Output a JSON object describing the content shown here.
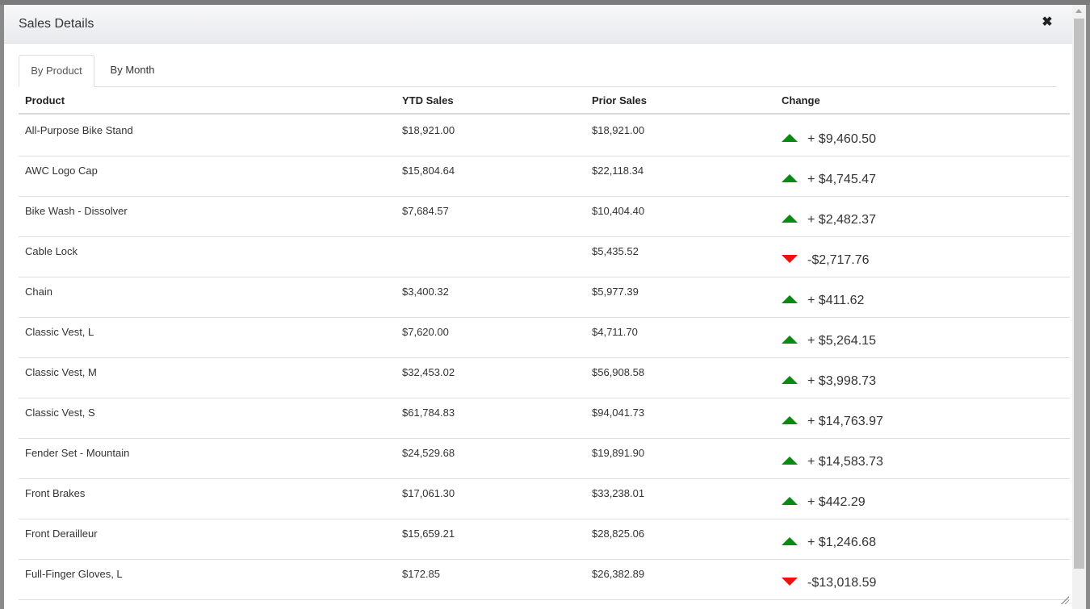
{
  "dialog": {
    "title": "Sales Details",
    "close_icon": "✖"
  },
  "tabs": [
    {
      "label": "By Product",
      "active": true
    },
    {
      "label": "By Month",
      "active": false
    }
  ],
  "table": {
    "columns": [
      "Product",
      "YTD Sales",
      "Prior Sales",
      "Change"
    ],
    "rows": [
      {
        "product": "All-Purpose Bike Stand",
        "ytd": "$18,921.00",
        "prior": "$18,921.00",
        "change": "+ $9,460.50",
        "trend": "up"
      },
      {
        "product": "AWC Logo Cap",
        "ytd": "$15,804.64",
        "prior": "$22,118.34",
        "change": "+ $4,745.47",
        "trend": "up"
      },
      {
        "product": "Bike Wash - Dissolver",
        "ytd": "$7,684.57",
        "prior": "$10,404.40",
        "change": "+ $2,482.37",
        "trend": "up"
      },
      {
        "product": "Cable Lock",
        "ytd": "",
        "prior": "$5,435.52",
        "change": "-$2,717.76",
        "trend": "down"
      },
      {
        "product": "Chain",
        "ytd": "$3,400.32",
        "prior": "$5,977.39",
        "change": "+ $411.62",
        "trend": "up"
      },
      {
        "product": "Classic Vest, L",
        "ytd": "$7,620.00",
        "prior": "$4,711.70",
        "change": "+ $5,264.15",
        "trend": "up"
      },
      {
        "product": "Classic Vest, M",
        "ytd": "$32,453.02",
        "prior": "$56,908.58",
        "change": "+ $3,998.73",
        "trend": "up"
      },
      {
        "product": "Classic Vest, S",
        "ytd": "$61,784.83",
        "prior": "$94,041.73",
        "change": "+ $14,763.97",
        "trend": "up"
      },
      {
        "product": "Fender Set - Mountain",
        "ytd": "$24,529.68",
        "prior": "$19,891.90",
        "change": "+ $14,583.73",
        "trend": "up"
      },
      {
        "product": "Front Brakes",
        "ytd": "$17,061.30",
        "prior": "$33,238.01",
        "change": "+ $442.29",
        "trend": "up"
      },
      {
        "product": "Front Derailleur",
        "ytd": "$15,659.21",
        "prior": "$28,825.06",
        "change": "+ $1,246.68",
        "trend": "up"
      },
      {
        "product": "Full-Finger Gloves, L",
        "ytd": "$172.85",
        "prior": "$26,382.89",
        "change": "-$13,018.59",
        "trend": "down"
      }
    ]
  },
  "colors": {
    "up": "#0a8a12",
    "down": "#ee1111"
  }
}
